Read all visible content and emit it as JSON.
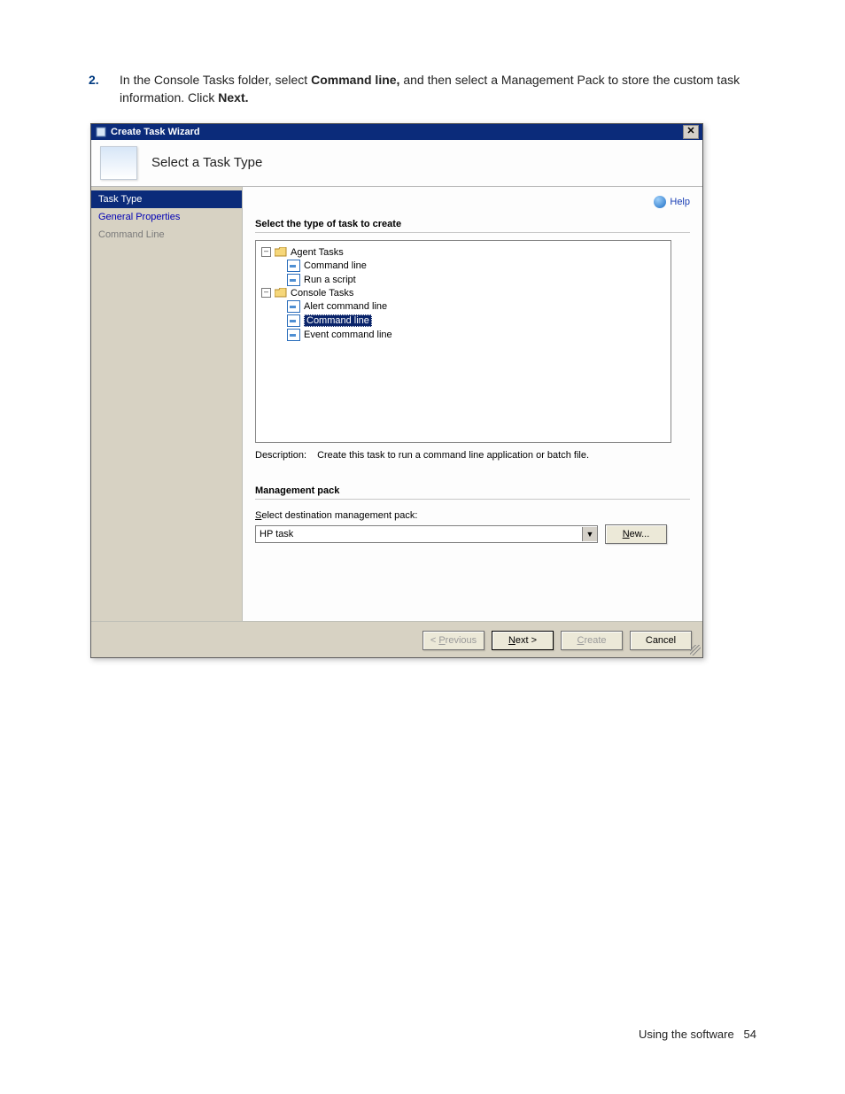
{
  "doc": {
    "step_number": "2.",
    "step_text_a": "In the Console Tasks folder, select ",
    "step_text_b": "Command line,",
    "step_text_c": " and then select a Management Pack to store the custom task information. Click ",
    "step_text_d": "Next."
  },
  "window": {
    "title": "Create Task Wizard",
    "banner": "Select a Task Type"
  },
  "side": {
    "items": [
      "Task Type",
      "General Properties",
      "Command Line"
    ]
  },
  "main": {
    "help": "Help",
    "section": "Select the type of task to create",
    "desc_label": "Description:",
    "desc_text": "Create this task to run a command line application or batch file.",
    "mp_heading": "Management pack",
    "mp_label_pre": "S",
    "mp_label_rest": "elect destination management pack:",
    "mp_value": "HP task",
    "new_pre": "N",
    "new_rest": "ew..."
  },
  "tree": {
    "root1": "Agent Tasks",
    "r1a": "Command line",
    "r1b": "Run a script",
    "root2": "Console Tasks",
    "r2a": "Alert command line",
    "r2b": "Command line",
    "r2c": "Event command line"
  },
  "buttons": {
    "prev_pre": "P",
    "prev_rest": "revious",
    "next_pre": "N",
    "next_rest": "ext >",
    "create_pre": "C",
    "create_rest": "reate",
    "cancel": "Cancel"
  },
  "footer": {
    "text": "Using the software",
    "page": "54"
  }
}
